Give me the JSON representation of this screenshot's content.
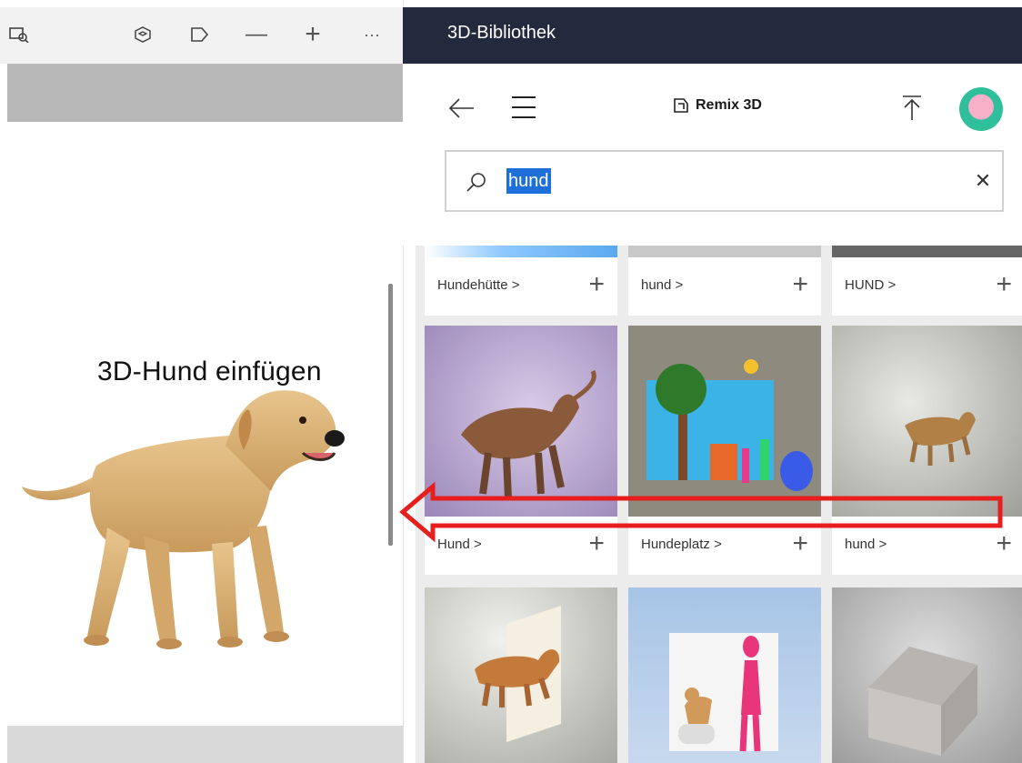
{
  "toolbar": {
    "icons": [
      "mixed-reality-icon",
      "3d-view-icon",
      "flag-icon",
      "zoom-out-icon",
      "zoom-in-icon",
      "more-icon"
    ],
    "zoom_out": "—",
    "zoom_in": "+",
    "more": "···"
  },
  "canvas": {
    "label": "3D-Hund einfügen"
  },
  "library": {
    "title": "3D-Bibliothek",
    "brand": "Remix 3D",
    "search": {
      "value": "hund",
      "clear": "✕"
    },
    "rows": [
      [
        {
          "label": "Hundehütte",
          "chevron": ">",
          "add": "+"
        },
        {
          "label": "hund",
          "chevron": ">",
          "add": "+"
        },
        {
          "label": "HUND",
          "chevron": ">",
          "add": "+"
        }
      ],
      [
        {
          "label": "Hund",
          "chevron": ">",
          "add": "+"
        },
        {
          "label": "Hundeplatz",
          "chevron": ">",
          "add": "+"
        },
        {
          "label": "hund",
          "chevron": ">",
          "add": "+"
        }
      ]
    ]
  },
  "colors": {
    "header_bg": "#242a3d",
    "arrow": "#e61e1e",
    "selection": "#1e6fd9"
  }
}
